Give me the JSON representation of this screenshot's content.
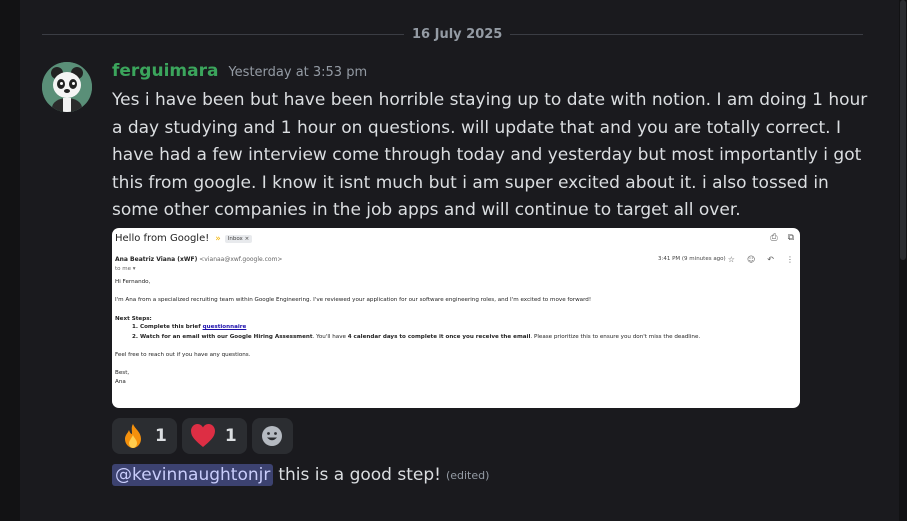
{
  "date_divider": "16 July 2025",
  "message": {
    "username": "ferguimara",
    "timestamp": "Yesterday at 3:53 pm",
    "text": "Yes i have been but have been horrible staying up to date with notion. I am doing 1 hour a day studying and 1 hour on questions. will update that and you are totally correct. I have had a few interview come through today and yesterday but most importantly i got this from google. I know it isnt much but i am super excited about it. i also tossed in some other companies in the job apps and will continue to target all over."
  },
  "email": {
    "subject": "Hello from Google!",
    "label": "Inbox ×",
    "sender_name": "Ana Beatriz Viana (xWF)",
    "sender_email": "<vianaa@xwf.google.com>",
    "to": "to me ▾",
    "time": "3:41 PM (9 minutes ago)",
    "greeting": "Hi Fernando,",
    "intro": "I'm Ana from a specialized recruiting team within Google Engineering. I've reviewed your application for our software engineering roles, and I'm excited to move forward!",
    "next_steps": "Next Steps:",
    "step1_prefix": "1.  Complete this brief ",
    "step1_link": "questionnaire",
    "step2_bold": "2.  Watch for an email with our Google Hiring Assessment",
    "step2_mid": ". You'll have ",
    "step2_bold2": "4 calendar days to complete it once you receive the email",
    "step2_end": ". Please prioritize this to ensure you don't miss the deadline.",
    "closing": "Feel free to reach out if you have any questions.",
    "sign1": "Best,",
    "sign2": "Ana"
  },
  "reactions": [
    {
      "emoji": "fire",
      "count": "1"
    },
    {
      "emoji": "red-heart",
      "count": "1"
    }
  ],
  "reply": {
    "mention": "@kevinnaughtonjr",
    "text": "this is a good step!",
    "edited": "(edited)"
  },
  "colors": {
    "background": "#1a1a1e",
    "username": "#3ba55c",
    "mention_bg": "#3c4270",
    "mention_text": "#c9cdfb"
  }
}
